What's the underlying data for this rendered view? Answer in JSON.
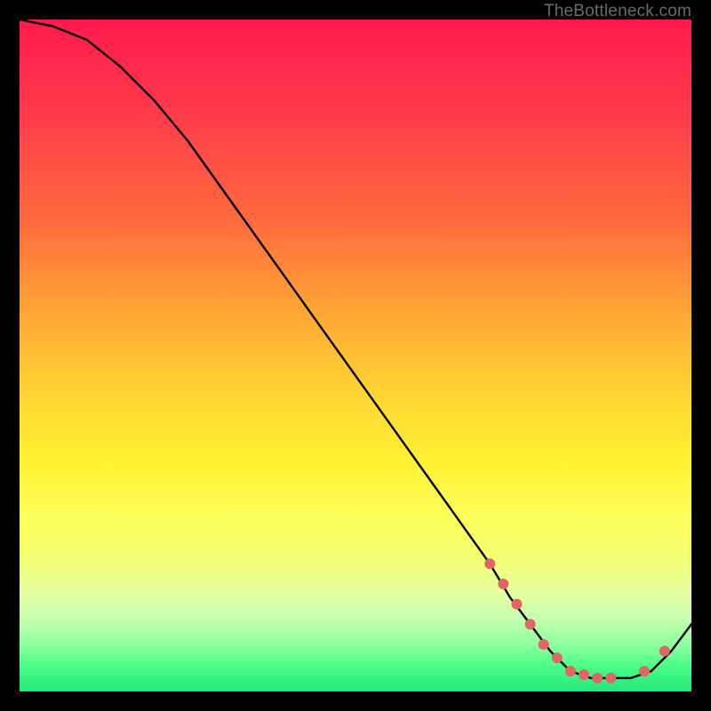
{
  "attribution": "TheBottleneck.com",
  "chart_data": {
    "type": "line",
    "title": "",
    "xlabel": "",
    "ylabel": "",
    "xlim": [
      0,
      100
    ],
    "ylim": [
      0,
      100
    ],
    "series": [
      {
        "name": "bottleneck-curve",
        "x": [
          0,
          5,
          10,
          15,
          20,
          25,
          30,
          35,
          40,
          45,
          50,
          55,
          60,
          65,
          70,
          73,
          76,
          79,
          82,
          85,
          88,
          91,
          94,
          97,
          100
        ],
        "values": [
          100,
          99,
          97,
          93,
          88,
          82,
          75,
          68,
          61,
          54,
          47,
          40,
          33,
          26,
          19,
          14,
          10,
          6,
          3,
          2,
          2,
          2,
          3,
          6,
          10
        ]
      }
    ],
    "markers": {
      "x": [
        70,
        72,
        74,
        76,
        78,
        80,
        82,
        84,
        86,
        88,
        93,
        96
      ],
      "values": [
        19,
        16,
        13,
        10,
        7,
        5,
        3,
        2.5,
        2,
        2,
        3,
        6
      ],
      "color": "#e06666",
      "radius": 6
    },
    "gradient_stops": [
      {
        "pos": 0,
        "color": "#ff1a4d"
      },
      {
        "pos": 14,
        "color": "#ff3b4a"
      },
      {
        "pos": 30,
        "color": "#ff6b3e"
      },
      {
        "pos": 44,
        "color": "#ffa834"
      },
      {
        "pos": 56,
        "color": "#ffd633"
      },
      {
        "pos": 66,
        "color": "#fff233"
      },
      {
        "pos": 74,
        "color": "#fdff5a"
      },
      {
        "pos": 80,
        "color": "#f4ff70"
      },
      {
        "pos": 85,
        "color": "#e8ffa0"
      },
      {
        "pos": 89,
        "color": "#c8ffb0"
      },
      {
        "pos": 93,
        "color": "#8effa0"
      },
      {
        "pos": 96,
        "color": "#4fff8a"
      },
      {
        "pos": 100,
        "color": "#20e878"
      }
    ]
  }
}
